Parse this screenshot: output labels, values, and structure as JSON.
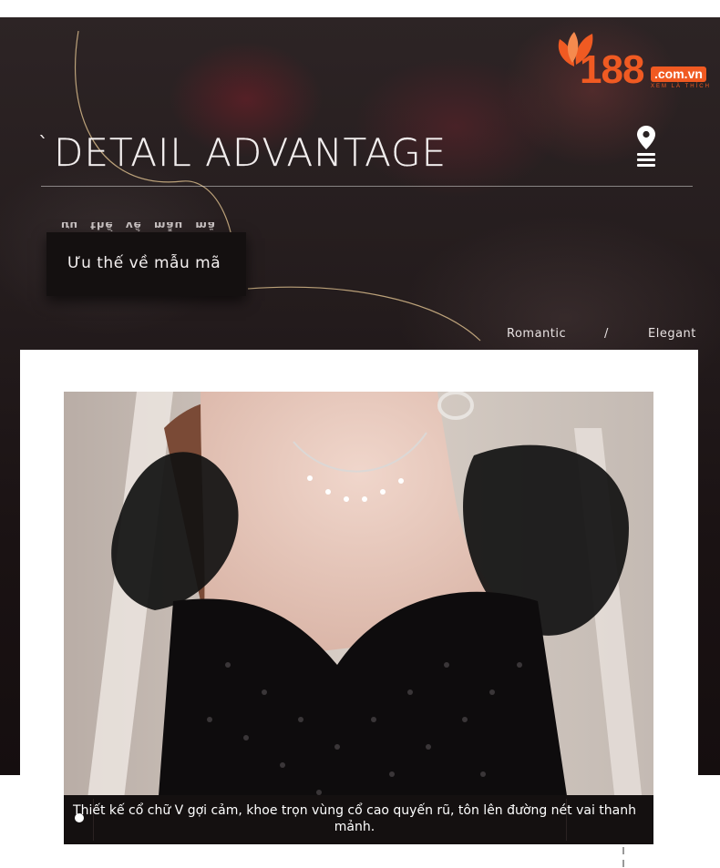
{
  "brand": {
    "number": "188",
    "domain": ".com.vn",
    "tagline": "XEM LÀ THÍCH",
    "color": "#f05a22"
  },
  "header": {
    "tick": "`",
    "title": "DETAIL ADVANTAGE",
    "mirror_caption": "ưu thế về mẫu mã",
    "subtitle": "Ưu thế về mẫu mã",
    "tags": {
      "left": "Romantic",
      "separator": "/",
      "right": "Elegant"
    }
  },
  "icons": {
    "location": "location-pin-icon",
    "menu": "hamburger-menu-icon"
  },
  "caption": {
    "text": "Thiết kế cổ chữ V gợi cảm, khoe trọn vùng cổ cao quyến rũ, tôn lên đường nét vai thanh mảnh."
  },
  "colors": {
    "hero_background": "#231b1c",
    "caption_bar": "#141010",
    "text_light": "#f2eeee"
  }
}
